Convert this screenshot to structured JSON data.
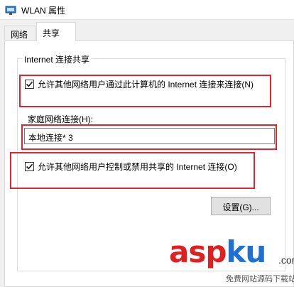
{
  "window": {
    "title": "WLAN 属性"
  },
  "tabs": [
    {
      "label": "网络",
      "active": false
    },
    {
      "label": "共享",
      "active": true
    }
  ],
  "group": {
    "title": "Internet 连接共享"
  },
  "allow_sharing": {
    "label": "允许其他网络用户通过此计算机的 Internet 连接来连接(N)",
    "checked": true
  },
  "home_network": {
    "label": "家庭网络连接(H):",
    "value": "本地连接* 3"
  },
  "allow_control": {
    "label": "允许其他网络用户控制或禁用共享的 Internet 连接(O)",
    "checked": true
  },
  "settings_button": {
    "label": "设置(G)..."
  },
  "watermark": {
    "text_a": "asp",
    "text_b": "ku",
    "sub": "免费网站源码下载站",
    "dot": ".com"
  },
  "colors": {
    "highlight": "#d9282f",
    "watermark_red": "#e02020",
    "watermark_blue": "#1f6fd6"
  }
}
